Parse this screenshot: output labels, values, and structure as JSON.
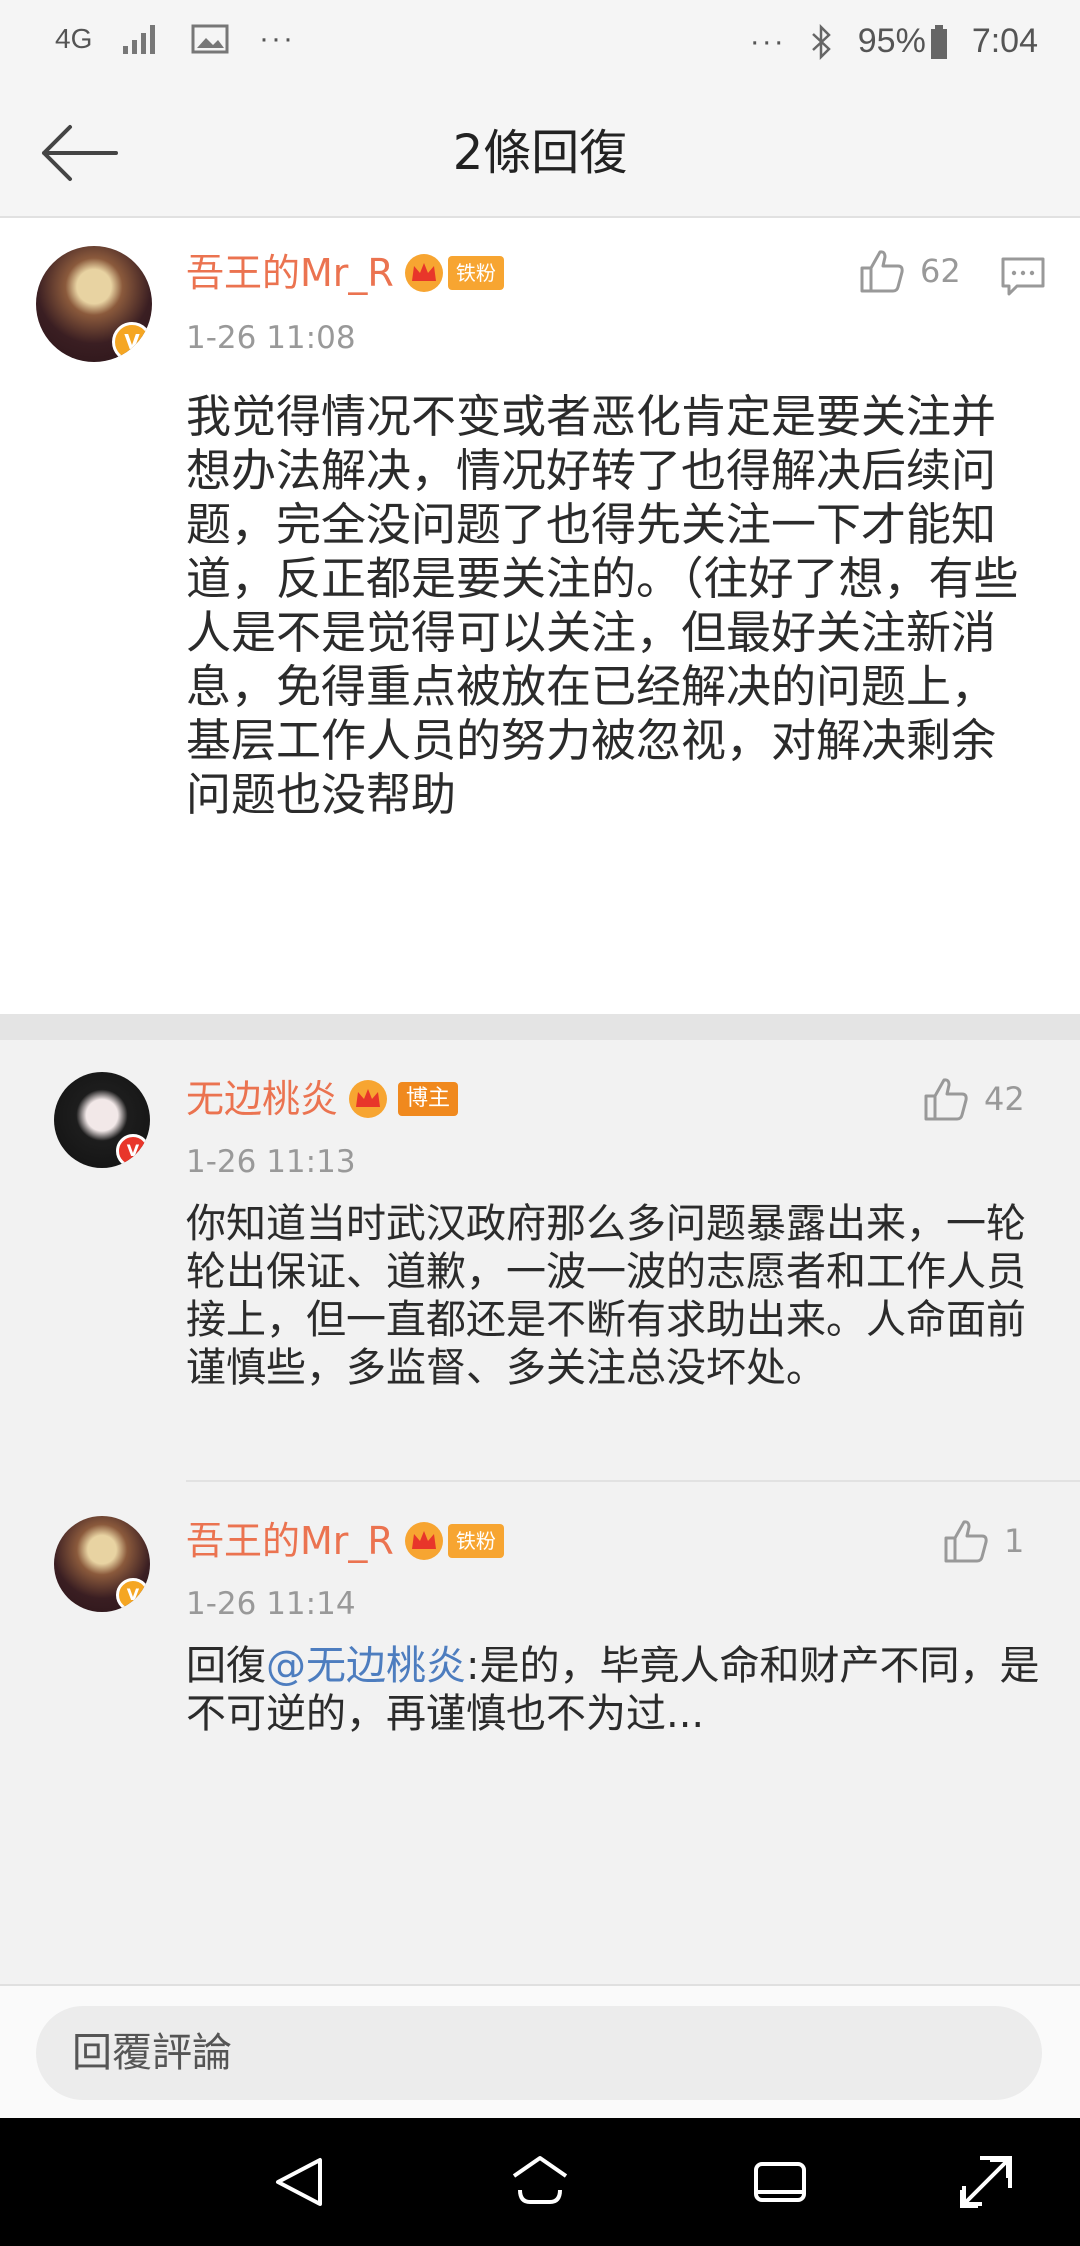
{
  "status_bar": {
    "network": "4G",
    "more_left": "···",
    "more_right": "···",
    "battery": "95%",
    "time": "7:04"
  },
  "header": {
    "title": "2條回復"
  },
  "main_comment": {
    "username": "吾王的Mr_R",
    "badge": "铁粉",
    "time": "1-26 11:08",
    "likes": "62",
    "text": "我觉得情况不变或者恶化肯定是要关注并想办法解决，情况好转了也得解决后续问题，完全没问题了也得先关注一下才能知道，反正都是要关注的。（往好了想，有些人是不是觉得可以关注，但最好关注新消息，免得重点被放在已经解决的问题上，基层工作人员的努力被忽视，对解决剩余问题也没帮助"
  },
  "replies": [
    {
      "username": "无边桃炎",
      "badge": "博主",
      "time": "1-26 11:13",
      "likes": "42",
      "text": "你知道当时武汉政府那么多问题暴露出来，一轮轮出保证、道歉，一波一波的志愿者和工作人员接上，但一直都还是不断有求助出来。人命面前谨慎些，多监督、多关注总没坏处。"
    },
    {
      "username": "吾王的Mr_R",
      "badge": "铁粉",
      "time": "1-26 11:14",
      "likes": "1",
      "reply_prefix": "回復",
      "mention": "@无边桃炎",
      "text": ":是的，毕竟人命和财产不同，是不可逆的，再谨慎也不为过..."
    }
  ],
  "input": {
    "placeholder": "回覆評論"
  },
  "colors": {
    "username": "#eb7350",
    "mention": "#4d7dbf",
    "badge": "#f7a531"
  },
  "icons": [
    "back-arrow-icon",
    "like-icon",
    "reply-bubble-icon",
    "crown-icon",
    "nav-back-icon",
    "nav-home-icon",
    "nav-recents-icon",
    "nav-expand-icon"
  ]
}
